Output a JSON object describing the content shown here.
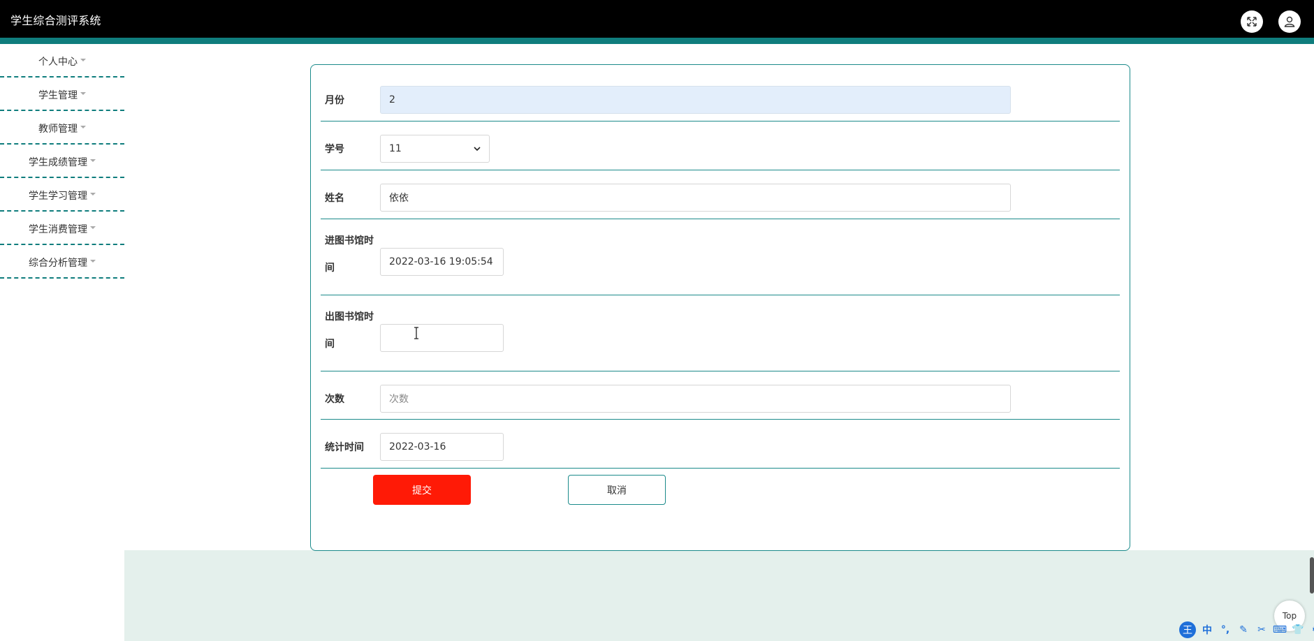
{
  "app": {
    "title": "学生综合测评系统"
  },
  "header": {
    "icons": [
      "fullscreen-icon",
      "user-icon"
    ]
  },
  "sidebar": {
    "items": [
      {
        "label": "个人中心"
      },
      {
        "label": "学生管理"
      },
      {
        "label": "教师管理"
      },
      {
        "label": "学生成绩管理"
      },
      {
        "label": "学生学习管理"
      },
      {
        "label": "学生消费管理"
      },
      {
        "label": "综合分析管理"
      }
    ]
  },
  "form": {
    "month": {
      "label": "月份",
      "value": "2"
    },
    "student_id": {
      "label": "学号",
      "value": "11"
    },
    "name": {
      "label": "姓名",
      "value": "依依"
    },
    "entry_time": {
      "label_line1": "进图书馆时",
      "label_line2": "间",
      "value": "2022-03-16 19:05:54"
    },
    "exit_time": {
      "label_line1": "出图书馆时",
      "label_line2": "间",
      "value": ""
    },
    "count": {
      "label": "次数",
      "placeholder": "次数"
    },
    "stat_time": {
      "label": "统计时间",
      "value": "2022-03-16"
    },
    "submit_label": "提交",
    "cancel_label": "取消"
  },
  "floating": {
    "top_label": "Top",
    "ime_label": "中"
  },
  "colors": {
    "accent": "#0f7d7d",
    "submit": "#ff1a06",
    "highlight_field": "#e3eefb",
    "bottom_band": "#e4f0ec"
  }
}
